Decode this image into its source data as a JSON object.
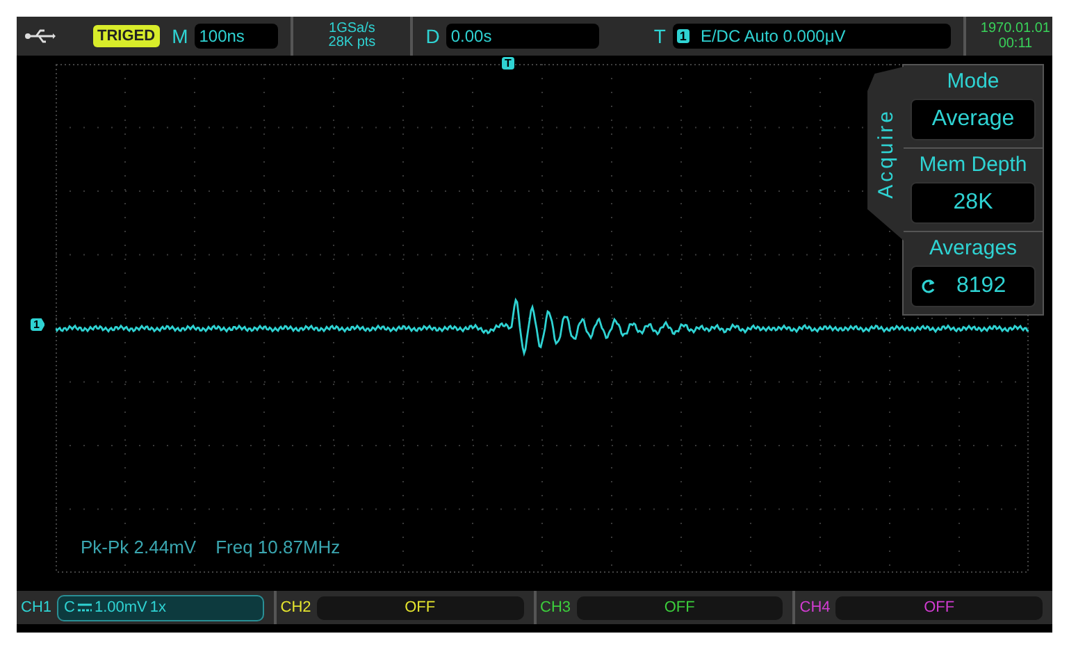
{
  "top_bar": {
    "trigger_status": "TRIGED",
    "timebase": {
      "label": "M",
      "value": "100ns"
    },
    "sample_rate": "1GSa/s",
    "memory": "28K pts",
    "delay": {
      "label": "D",
      "value": "0.00s"
    },
    "trigger": {
      "label": "T",
      "channel": "1",
      "info": "E/DC Auto 0.000μV"
    },
    "date": "1970.01.01",
    "time": "00:11"
  },
  "plot": {
    "trigger_marker": "T",
    "channel_marker": "1",
    "measurements": [
      "Pk-Pk 2.44mV",
      "Freq 10.87MHz"
    ]
  },
  "menu": {
    "title": "Acquire",
    "items": [
      {
        "label": "Mode",
        "value": "Average",
        "kind": "value"
      },
      {
        "label": "Mem Depth",
        "value": "28K",
        "kind": "value"
      },
      {
        "label": "Averages",
        "value": "8192",
        "kind": "knob"
      }
    ]
  },
  "channels": [
    {
      "label": "CH1",
      "color": "#2fd3d3",
      "on": true,
      "coupling": "C",
      "scale": "1.00mV",
      "probe": "1x"
    },
    {
      "label": "CH2",
      "color": "#e6e62e",
      "on": false,
      "status": "OFF"
    },
    {
      "label": "CH3",
      "color": "#3ccf3c",
      "on": false,
      "status": "OFF"
    },
    {
      "label": "CH4",
      "color": "#d23cd2",
      "on": false,
      "status": "OFF"
    }
  ]
}
